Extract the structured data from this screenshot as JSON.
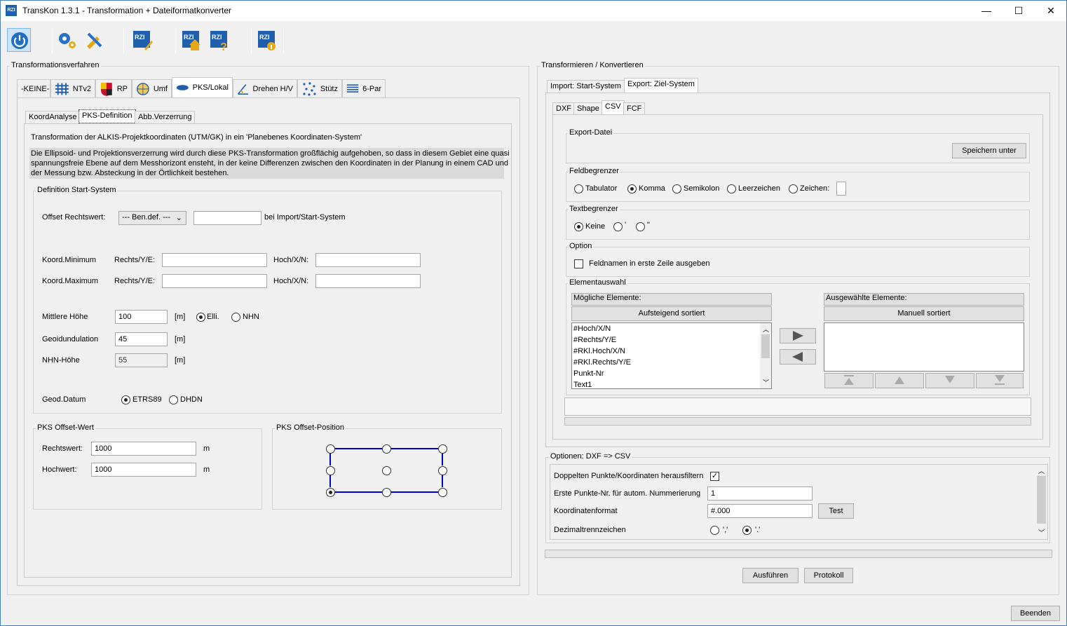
{
  "window": {
    "title": "TransKon 1.3.1 - Transformation + Dateiformatkonverter",
    "app_icon_text": "RZI",
    "minimize": "—",
    "maximize": "☐",
    "close": "✕"
  },
  "toolbar": {
    "rzi_text": "RZI"
  },
  "left_panel": {
    "title": "Transformationsverfahren",
    "tabs": [
      {
        "label": "-KEINE-"
      },
      {
        "label": "NTv2"
      },
      {
        "label": "RP"
      },
      {
        "label": "Umf"
      },
      {
        "label": "PKS/Lokal"
      },
      {
        "label": "Drehen H/V"
      },
      {
        "label": "Stütz"
      },
      {
        "label": "6-Par"
      }
    ],
    "subtabs": [
      {
        "label": "KoordAnalyse"
      },
      {
        "label": "PKS-Definition"
      },
      {
        "label": "Abb.Verzerrung"
      }
    ],
    "description_title": "Transformation der ALKIS-Projektkoordinaten (UTM/GK) in ein 'Planebenes Koordinaten-System'",
    "description_lines": [
      "Die Ellipsoid- und Projektionsverzerrung wird durch diese PKS-Transformation großflächig aufgehoben, so dass in diesem Gebiet eine quasi",
      "spannungsfreie Ebene auf dem Messhorizont ensteht, in der keine Differenzen zwischen den Koordinaten in der Planung in einem CAD und",
      "der Messung bzw. Absteckung in der Örtlichkeit bestehen."
    ],
    "start_system": {
      "title": "Definition Start-System",
      "offset_label": "Offset Rechtswert:",
      "offset_select": "--- Ben.def. ---",
      "offset_value": "",
      "offset_suffix": "bei Import/Start-System",
      "koord_min": "Koord.Minimum",
      "koord_max": "Koord.Maximum",
      "rechts_label": "Rechts/Y/E:",
      "hoch_label": "Hoch/X/N:",
      "min_rechts": "",
      "min_hoch": "",
      "max_rechts": "",
      "max_hoch": "",
      "mittlere_hoehe_label": "Mittlere Höhe",
      "mittlere_hoehe": "100",
      "unit_m": "[m]",
      "elli": "Elli.",
      "nhn": "NHN",
      "geoid_label": "Geoidundulation",
      "geoid": "45",
      "nhn_hoehe_label": "NHN-Höhe",
      "nhn_hoehe": "55",
      "datum_label": "Geod.Datum",
      "etrs": "ETRS89",
      "dhdn": "DHDN"
    },
    "offset_wert": {
      "title": "PKS Offset-Wert",
      "rechts_label": "Rechtswert:",
      "rechts": "1000",
      "hoch_label": "Hochwert:",
      "hoch": "1000",
      "unit": "m"
    },
    "offset_position": {
      "title": "PKS Offset-Position",
      "selected": "bottom-left"
    }
  },
  "right_panel": {
    "title": "Transformieren / Konvertieren",
    "tabs": [
      {
        "label": "Import: Start-System"
      },
      {
        "label": "Export: Ziel-System"
      }
    ],
    "subtabs": [
      {
        "label": "DXF"
      },
      {
        "label": "Shape"
      },
      {
        "label": "CSV"
      },
      {
        "label": "FCF"
      }
    ],
    "export_file": {
      "title": "Export-Datei",
      "save_as": "Speichern unter"
    },
    "field_delim": {
      "title": "Feldbegrenzer",
      "options": [
        "Tabulator",
        "Komma",
        "Semikolon",
        "Leerzeichen",
        "Zeichen:"
      ],
      "selected": "Komma",
      "custom_char": ""
    },
    "text_delim": {
      "title": "Textbegrenzer",
      "options": [
        "Keine",
        "'",
        "\""
      ],
      "selected": "Keine"
    },
    "option": {
      "title": "Option",
      "fieldnames_label": "Feldnamen in erste Zeile ausgeben",
      "fieldnames_checked": false
    },
    "element_select": {
      "title": "Elementauswahl",
      "possible_header": "Mögliche Elemente:",
      "possible_sort": "Aufsteigend sortiert",
      "possible_items": [
        "#Hoch/X/N",
        "#Rechts/Y/E",
        "#RKl.Hoch/X/N",
        "#RKl.Rechts/Y/E",
        "Punkt-Nr",
        "Text1"
      ],
      "selected_header": "Ausgewählte Elemente:",
      "selected_sort": "Manuell sortiert",
      "selected_items": []
    },
    "options_dxf_csv": {
      "title": "Optionen: DXF => CSV",
      "filter_dup_label": "Doppelten Punkte/Koordinaten herausfiltern",
      "filter_dup_checked": true,
      "first_nr_label": "Erste Punkte-Nr. für autom. Nummerierung",
      "first_nr": "1",
      "format_label": "Koordinatenformat",
      "format": "#.000",
      "test_button": "Test",
      "decimal_label": "Dezimaltrennzeichen",
      "decimal_options": [
        "','",
        "'.'"
      ],
      "decimal_selected": "'.'"
    },
    "execute": "Ausführen",
    "protocol": "Protokoll"
  },
  "footer": {
    "quit": "Beenden"
  },
  "colors": {
    "accent": "#1f5fae",
    "offset_line": "#0000cc"
  }
}
